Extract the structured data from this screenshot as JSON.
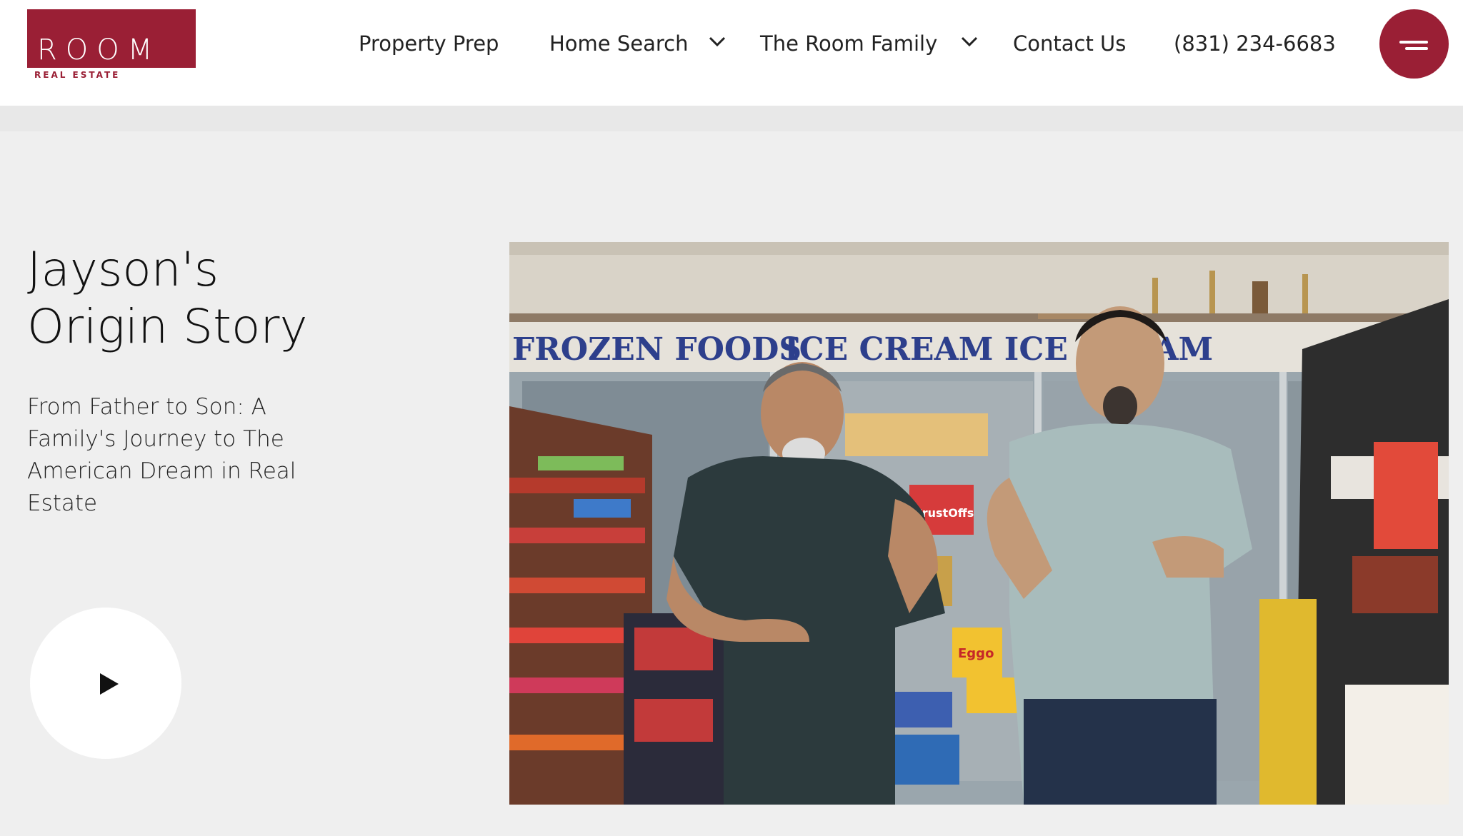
{
  "header": {
    "logo": {
      "word": "ROOM",
      "sub": "REAL ESTATE"
    },
    "nav": [
      {
        "label": "Property Prep",
        "has_dropdown": false
      },
      {
        "label": "Home Search",
        "has_dropdown": true
      },
      {
        "label": "The Room Family",
        "has_dropdown": true
      },
      {
        "label": "Contact Us",
        "has_dropdown": false
      }
    ],
    "phone": "(831) 234-6683",
    "menu_icon": "menu-icon"
  },
  "hero": {
    "title_line1": "Jayson's",
    "title_line2": "Origin Story",
    "subtitle": "From Father to Son: A Family's Journey to The American Dream in Real Estate",
    "play_icon": "play-icon"
  },
  "video": {
    "sign_frozen": "FROZEN FOODS",
    "sign_icecream": "ICE CREAM ICE CREAM",
    "crustoffs": "CrustOffs",
    "eggo": "Eggo"
  },
  "colors": {
    "brand": "#9a1f35",
    "page_bg": "#efefef",
    "header_bg": "#ffffff"
  }
}
